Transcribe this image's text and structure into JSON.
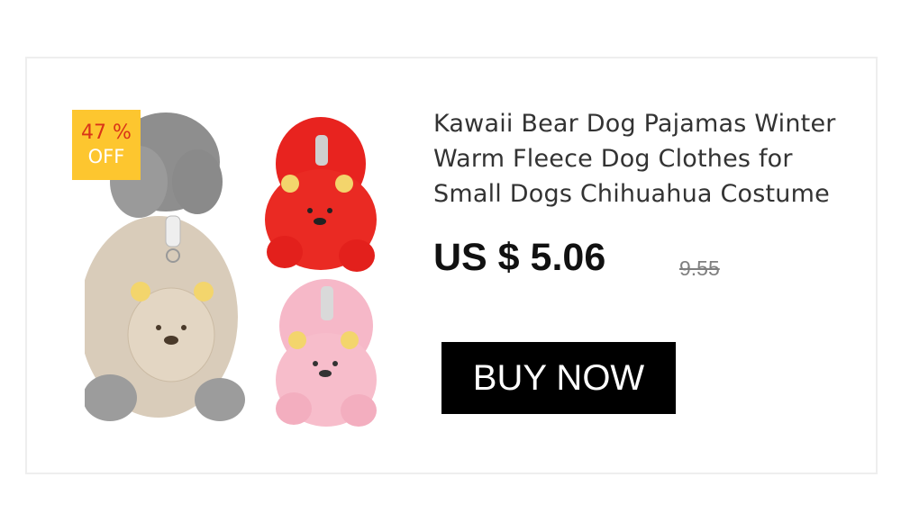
{
  "badge": {
    "percent": "47 %",
    "off": "OFF"
  },
  "product": {
    "title": "Kawaii Bear Dog Pajamas Winter Warm Fleece Dog Clothes for Small Dogs Chihuahua Costume",
    "price": "US $ 5.06",
    "old_price": "9.55",
    "buy_label": "BUY NOW"
  },
  "colors": {
    "badge_bg": "#fdc62f",
    "badge_percent": "#d93418",
    "button_bg": "#000000",
    "card_border": "#eeeeee"
  }
}
